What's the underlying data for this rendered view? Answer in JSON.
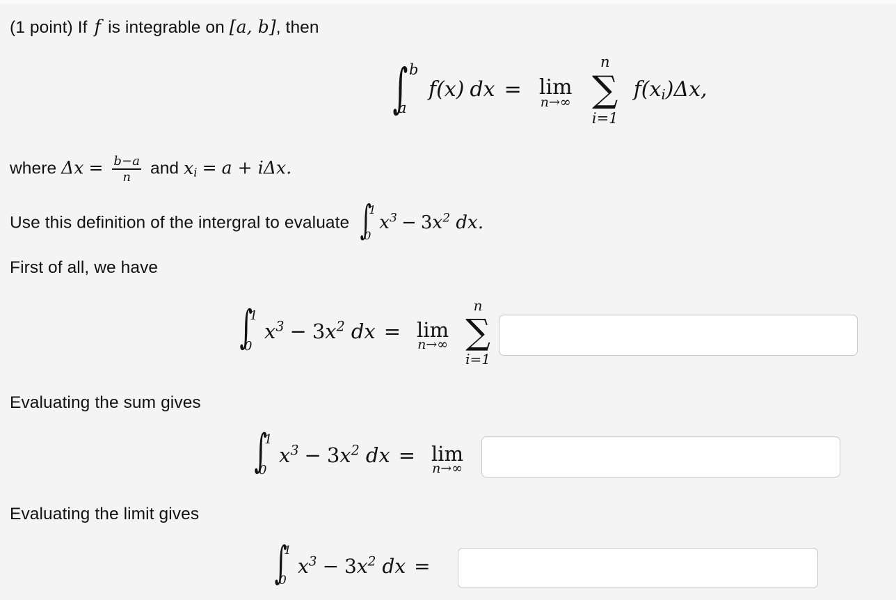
{
  "page": {
    "background_color": "#f4f4f4",
    "text_color": "#121212",
    "input_border_color": "#c8c8c8",
    "input_background_color": "#ffffff"
  },
  "problem": {
    "points_label": "(1 point)",
    "intro_before_f": "If",
    "intro_f": "f",
    "intro_after_f": "is integrable on",
    "interval": "[a, b]",
    "intro_end": ", then",
    "statement_line": "(1 point) If f is integrable on [a, b], then"
  },
  "definition_equation": {
    "integral_lower": "a",
    "integral_upper": "b",
    "integrand": "f(x)",
    "differential": "dx",
    "equals": "=",
    "limit_label": "lim",
    "limit_sub": "n→∞",
    "sum_symbol": "∑",
    "sum_upper": "n",
    "sum_lower": "i=1",
    "summand": "f(x",
    "summand_sub": "i",
    "summand_close": ")Δx,",
    "plain": "∫_a^b f(x) dx = lim_{n→∞} ∑_{i=1}^{n} f(x_i)Δx,"
  },
  "where_line": {
    "prefix": "where",
    "delta_x": "Δx",
    "equals": "=",
    "frac_numerator": "b−a",
    "frac_denominator": "n",
    "conjunction": "and",
    "x_sub": "x",
    "x_sub_index": "i",
    "equals2": "=",
    "rhs": "a + iΔx.",
    "plain": "where Δx = (b−a)/n and x_i = a + iΔx."
  },
  "instruction_line": {
    "text": "Use this definition of the intergral to evaluate",
    "integral_lower": "0",
    "integral_upper": "1",
    "integrand_x": "x",
    "integrand_x_exp": "3",
    "minus": "−",
    "coef": "3",
    "second_x": "x",
    "second_x_exp": "2",
    "differential": "dx",
    "period": ".",
    "plain": "Use this definition of the intergral to evaluate ∫_0^1 x^3 − 3x^2 dx."
  },
  "steps": [
    {
      "label": "First of all, we have",
      "equation": {
        "integral_lower": "0",
        "integral_upper": "1",
        "x": "x",
        "x_exp": "3",
        "minus": "−",
        "coef": "3",
        "x2": "x",
        "x2_exp": "2",
        "differential": "dx",
        "equals": "=",
        "limit_label": "lim",
        "limit_sub": "n→∞",
        "sum_symbol": "∑",
        "sum_upper": "n",
        "sum_lower": "i=1",
        "plain": "∫_0^1 x^3 − 3x^2 dx = lim_{n→∞} ∑_{i=1}^{n}"
      },
      "input": {
        "value": "",
        "placeholder": ""
      }
    },
    {
      "label": "Evaluating the sum gives",
      "equation": {
        "integral_lower": "0",
        "integral_upper": "1",
        "x": "x",
        "x_exp": "3",
        "minus": "−",
        "coef": "3",
        "x2": "x",
        "x2_exp": "2",
        "differential": "dx",
        "equals": "=",
        "limit_label": "lim",
        "limit_sub": "n→∞",
        "plain": "∫_0^1 x^3 − 3x^2 dx = lim_{n→∞}"
      },
      "input": {
        "value": "",
        "placeholder": ""
      }
    },
    {
      "label": "Evaluating the limit gives",
      "equation": {
        "integral_lower": "0",
        "integral_upper": "1",
        "x": "x",
        "x_exp": "3",
        "minus": "−",
        "coef": "3",
        "x2": "x",
        "x2_exp": "2",
        "differential": "dx",
        "equals": "=",
        "plain": "∫_0^1 x^3 − 3x^2 dx ="
      },
      "input": {
        "value": "",
        "placeholder": ""
      }
    }
  ]
}
